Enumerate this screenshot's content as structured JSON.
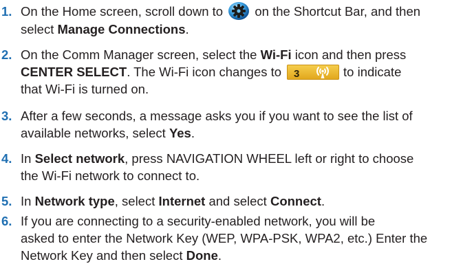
{
  "steps": [
    {
      "number": "1.",
      "lines": [
        [
          {
            "t": "text",
            "v": "On the Home screen, scroll down to "
          },
          {
            "t": "icon",
            "name": "settings-orb-icon"
          },
          {
            "t": "text",
            "v": " on the Shortcut Bar, and then"
          }
        ],
        [
          {
            "t": "text",
            "v": "select "
          },
          {
            "t": "bold",
            "v": "Manage Connections"
          },
          {
            "t": "text",
            "v": "."
          }
        ]
      ]
    },
    {
      "number": "2.",
      "lines": [
        [
          {
            "t": "text",
            "v": "On the Comm Manager screen, select the "
          },
          {
            "t": "bold",
            "v": "Wi-Fi"
          },
          {
            "t": "text",
            "v": " icon and then press"
          }
        ],
        [
          {
            "t": "bold",
            "v": "CENTER SELECT"
          },
          {
            "t": "text",
            "v": ". The Wi-Fi icon changes to"
          },
          {
            "t": "badge",
            "name": "wifi-on-badge-icon",
            "label": "3"
          },
          {
            "t": "text",
            "v": "to indicate"
          }
        ],
        [
          {
            "t": "text",
            "v": "that Wi-Fi is turned on."
          }
        ]
      ]
    },
    {
      "number": "3.",
      "lines": [
        [
          {
            "t": "text",
            "v": "After a few seconds, a message asks you if you want to see the list of"
          }
        ],
        [
          {
            "t": "text",
            "v": "available networks, select "
          },
          {
            "t": "bold",
            "v": "Yes"
          },
          {
            "t": "text",
            "v": "."
          }
        ]
      ]
    },
    {
      "number": "4.",
      "lines": [
        [
          {
            "t": "text",
            "v": "In "
          },
          {
            "t": "bold",
            "v": "Select network"
          },
          {
            "t": "text",
            "v": ", press NAVIGATION WHEEL left or right to choose"
          }
        ],
        [
          {
            "t": "text",
            "v": "the Wi-Fi network to connect to."
          }
        ]
      ]
    },
    {
      "number": "5.",
      "lines": [
        [
          {
            "t": "text",
            "v": "In "
          },
          {
            "t": "bold",
            "v": "Network type"
          },
          {
            "t": "text",
            "v": ", select "
          },
          {
            "t": "bold",
            "v": "Internet"
          },
          {
            "t": "text",
            "v": " and select "
          },
          {
            "t": "bold",
            "v": "Connect"
          },
          {
            "t": "text",
            "v": "."
          }
        ]
      ]
    },
    {
      "number": "6.",
      "lines": [
        [
          {
            "t": "text",
            "v": "If you are connecting to a security-enabled network, you will be"
          }
        ],
        [
          {
            "t": "text",
            "v": "asked to enter the Network Key (WEP, WPA-PSK, WPA2, etc.) Enter the"
          }
        ],
        [
          {
            "t": "text",
            "v": "Network Key and then select "
          },
          {
            "t": "bold",
            "v": "Done"
          },
          {
            "t": "text",
            "v": "."
          }
        ]
      ]
    }
  ]
}
